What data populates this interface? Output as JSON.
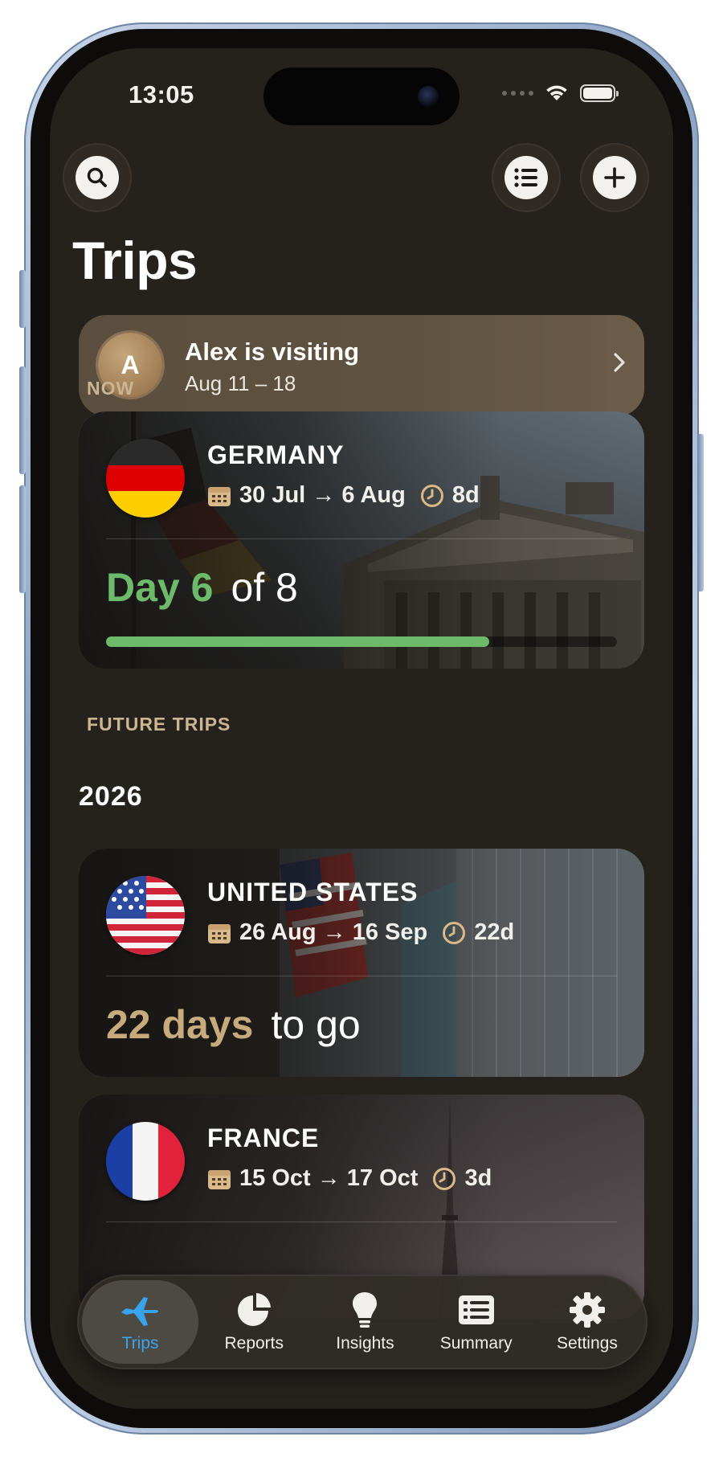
{
  "status_bar": {
    "time": "13:05"
  },
  "header": {
    "title": "Trips"
  },
  "visitor_banner": {
    "avatar_initial": "A",
    "name": "Alex is visiting",
    "dates": "Aug 11 – 18"
  },
  "sections": {
    "now": "NOW",
    "future": "FUTURE TRIPS",
    "year": "2026"
  },
  "trips": [
    {
      "country": "GERMANY",
      "dates": "30 Jul → 6 Aug",
      "duration": "8d",
      "highlight": "Day 6",
      "rest": "of 8",
      "progress": 0.75,
      "highlight_color": "#6dbb6a"
    },
    {
      "country": "UNITED STATES",
      "dates": "26 Aug → 16 Sep",
      "duration": "22d",
      "highlight": "22 days",
      "rest": "to go",
      "highlight_color": "#c7ab7d"
    },
    {
      "country": "FRANCE",
      "dates": "15 Oct → 17 Oct",
      "duration": "3d"
    }
  ],
  "tabs": [
    {
      "label": "Trips",
      "icon": "airplane-icon",
      "active": true
    },
    {
      "label": "Reports",
      "icon": "pie-chart-icon",
      "active": false
    },
    {
      "label": "Insights",
      "icon": "lightbulb-icon",
      "active": false
    },
    {
      "label": "Summary",
      "icon": "list-card-icon",
      "active": false
    },
    {
      "label": "Settings",
      "icon": "gear-icon",
      "active": false
    }
  ],
  "colors": {
    "background": "#25211d",
    "accent_active_tab": "#38a4f0",
    "now_progress": "#6dbb6a",
    "section_label": "#cbb593"
  }
}
